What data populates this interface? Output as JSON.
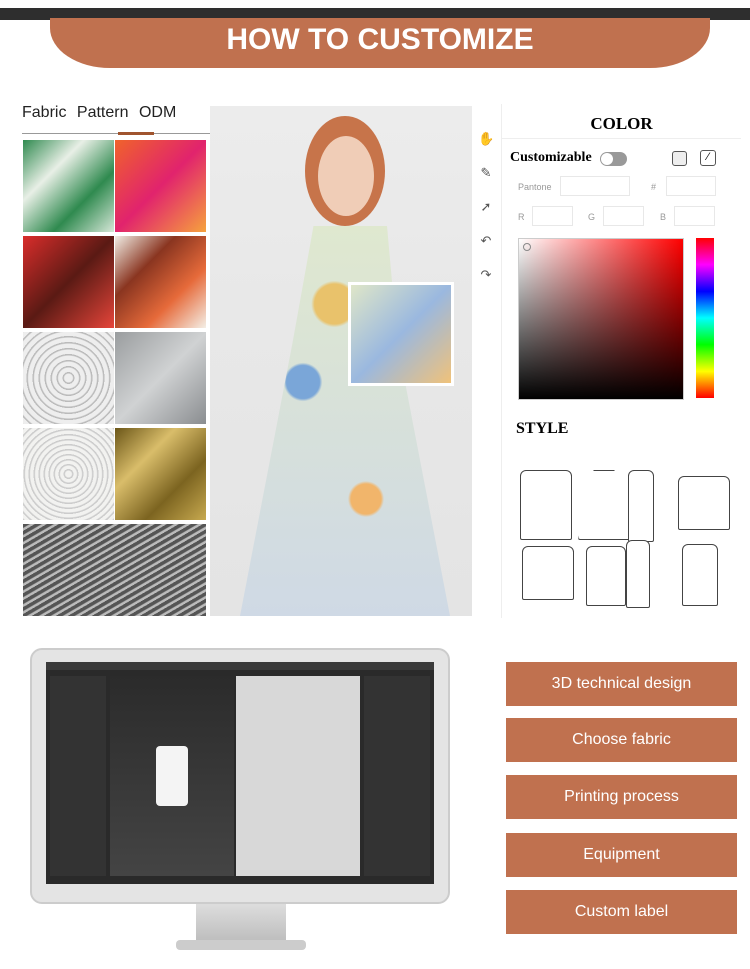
{
  "header": {
    "title": "HOW TO CUSTOMIZE"
  },
  "tabs": [
    "Fabric",
    "Pattern",
    "ODM"
  ],
  "color_panel": {
    "title": "COLOR",
    "customizable_label": "Customizable",
    "toggle_on": false,
    "pantone_label": "Pantone",
    "hash_label": "#",
    "r_label": "R",
    "g_label": "G",
    "b_label": "B"
  },
  "style_panel": {
    "title": "STYLE"
  },
  "tools": [
    "hand-icon",
    "pen-icon",
    "pointer-icon",
    "undo-icon",
    "redo-icon"
  ],
  "features": [
    "3D technical design",
    "Choose fabric",
    "Printing process",
    "Equipment",
    "Custom label"
  ],
  "colors": {
    "accent": "#c0714f"
  }
}
